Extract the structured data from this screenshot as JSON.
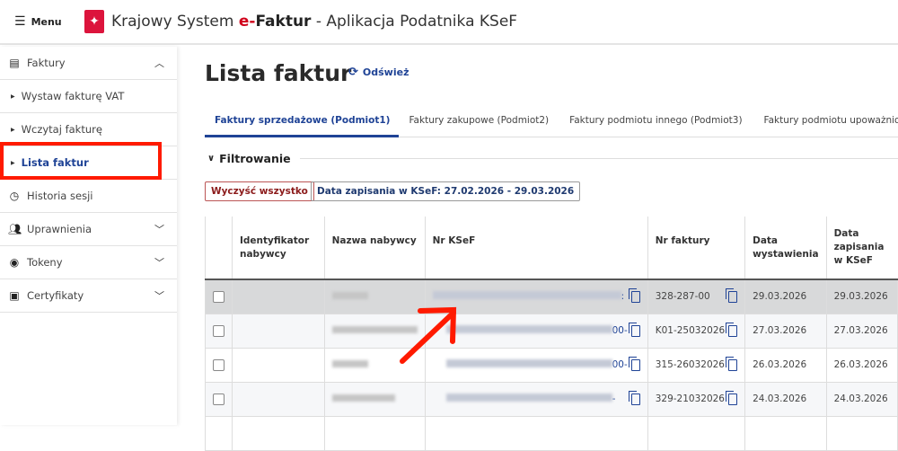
{
  "header": {
    "menu_label": "Menu",
    "title_prefix": "Krajowy System ",
    "title_e": "e-",
    "title_brand": "Faktur",
    "title_suffix": " - Aplikacja Podatnika KSeF"
  },
  "sidebar": {
    "items": [
      {
        "label": "Faktury",
        "icon": "document-icon",
        "expanded": true
      },
      {
        "label": "Wystaw fakturę VAT"
      },
      {
        "label": "Wczytaj fakturę"
      },
      {
        "label": "Lista faktur",
        "active": true
      },
      {
        "label": "Historia sesji",
        "icon": "clock-icon"
      },
      {
        "label": "Uprawnienia",
        "icon": "people-icon"
      },
      {
        "label": "Tokeny",
        "icon": "token-icon"
      },
      {
        "label": "Certyfikaty",
        "icon": "certificate-icon"
      }
    ]
  },
  "main": {
    "title": "Lista faktur",
    "refresh_label": "Odśwież",
    "tabs": [
      "Faktury sprzedażowe (Podmiot1)",
      "Faktury zakupowe (Podmiot2)",
      "Faktury podmiotu innego (Podmiot3)",
      "Faktury podmiotu upoważnionego"
    ],
    "filter_label": "Filtrowanie",
    "clear_label": "Wyczyść wszystko",
    "date_chip": "Data zapisania w KSeF: 27.02.2026 - 29.03.2026",
    "columns": [
      "Identyfikator nabywcy",
      "Nazwa nabywcy",
      "Nr KSeF",
      "Nr faktury",
      "Data wystawienia",
      "Data zapisania w KSeF"
    ],
    "rows": [
      {
        "ksef_tail": ":",
        "nr": "328-287-00",
        "wyst": "29.03.2026",
        "zap": "29.03.2026"
      },
      {
        "ksef_tail": "00-",
        "nr": "K01-25032026",
        "wyst": "27.03.2026",
        "zap": "27.03.2026"
      },
      {
        "ksef_tail": "00-",
        "nr": "315-26032026",
        "wyst": "26.03.2026",
        "zap": "26.03.2026"
      },
      {
        "ksef_tail": "-",
        "nr": "329-21032026",
        "wyst": "24.03.2026",
        "zap": "24.03.2026"
      }
    ]
  },
  "colors": {
    "accent": "#1f4396",
    "danger": "#8b1a1a",
    "annotation": "#ff1a00"
  }
}
